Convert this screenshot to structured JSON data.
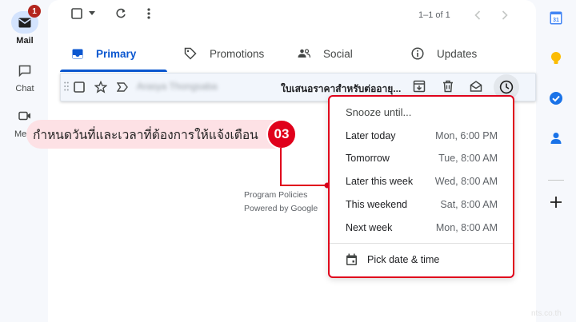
{
  "rail": {
    "mail_label": "Mail",
    "mail_badge": "1",
    "chat_label": "Chat",
    "meet_label": "Me"
  },
  "toolbar": {
    "pager": "1–1 of 1"
  },
  "tabs": [
    {
      "label": "Primary",
      "icon": "inbox-icon",
      "active": true
    },
    {
      "label": "Promotions",
      "icon": "tag-icon"
    },
    {
      "label": "Social",
      "icon": "people-icon"
    },
    {
      "label": "Updates",
      "icon": "info-icon"
    }
  ],
  "email": {
    "sender": "Arasya Thongsaba",
    "subject": "ใบเสนอราคาสำหรับต่ออายุ..."
  },
  "footer": {
    "policies": "Program Policies",
    "powered": "Powered by Google"
  },
  "callout": {
    "text": "กำหนดวันที่และเวลาที่ต้องการให้แจ้งเตือน",
    "step": "03"
  },
  "snooze": {
    "title": "Snooze until...",
    "options": [
      {
        "label": "Later today",
        "when": "Mon, 6:00 PM"
      },
      {
        "label": "Tomorrow",
        "when": "Tue, 8:00 AM"
      },
      {
        "label": "Later this week",
        "when": "Wed, 8:00 AM"
      },
      {
        "label": "This weekend",
        "when": "Sat, 8:00 AM"
      },
      {
        "label": "Next week",
        "when": "Mon, 8:00 AM"
      }
    ],
    "pick": "Pick date & time"
  },
  "right_rail": {
    "calendar_day": "31"
  },
  "watermark": "nts.co.th",
  "colors": {
    "accent": "#0b57d0",
    "highlight": "#e0001b",
    "callout_bg": "#fde1e5"
  }
}
